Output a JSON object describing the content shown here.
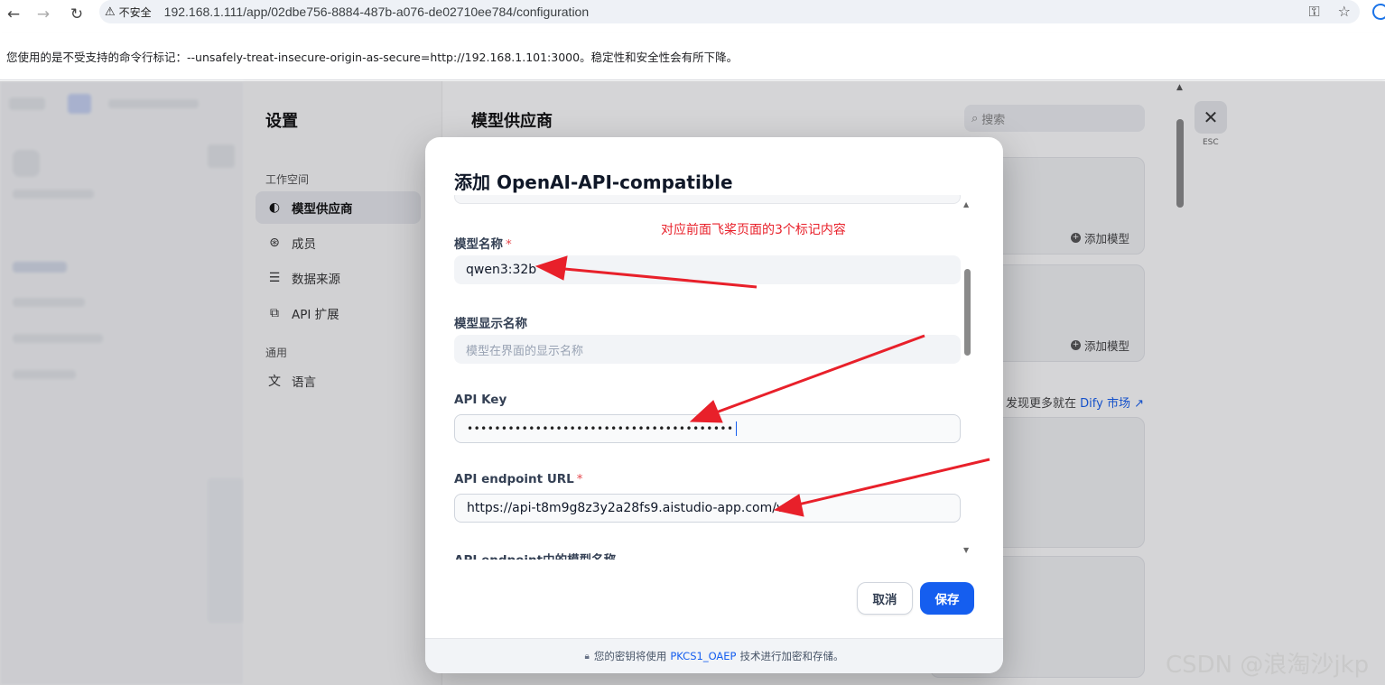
{
  "browser": {
    "insecure_label": "不安全",
    "url": "192.168.1.111/app/02dbe756-8884-487b-a076-de02710ee784/configuration",
    "infobar_text": "您使用的是不受支持的命令行标记：--unsafely-treat-insecure-origin-as-secure=http://192.168.1.101:3000。稳定性和安全性会有所下降。"
  },
  "settings": {
    "title": "设置",
    "workspace_label": "工作空间",
    "general_label": "通用",
    "items": [
      {
        "label": "模型供应商",
        "icon": "brain-icon"
      },
      {
        "label": "成员",
        "icon": "members-icon"
      },
      {
        "label": "数据来源",
        "icon": "database-icon"
      },
      {
        "label": "API 扩展",
        "icon": "puzzle-icon"
      },
      {
        "label": "语言",
        "icon": "translate-icon"
      }
    ]
  },
  "main": {
    "title": "模型供应商",
    "search_placeholder": "搜索",
    "add_model_label": "添加模型",
    "discover_text": "发现更多就在",
    "discover_link": "Dify 市场 ↗",
    "esc_label": "ESC"
  },
  "modal": {
    "title": "添加 OpenAI-API-compatible",
    "fields": {
      "model_name": {
        "label": "模型名称",
        "required": "*",
        "value": "qwen3:32b"
      },
      "display_name": {
        "label": "模型显示名称",
        "placeholder": "模型在界面的显示名称"
      },
      "api_key": {
        "label": "API Key",
        "value": "•••••••••••••••••••••••••••••••••••••••"
      },
      "endpoint_url": {
        "label": "API endpoint URL",
        "required": "*",
        "value": "https://api-t8m9g8z3y2a28fs9.aistudio-app.com/v1"
      },
      "endpoint_model_name": {
        "label": "API endpoint中的模型名称"
      }
    },
    "cancel_label": "取消",
    "save_label": "保存",
    "footer_prefix": "您的密钥将使用",
    "footer_link": "PKCS1_OAEP",
    "footer_suffix": "技术进行加密和存储。"
  },
  "annotation": {
    "text": "对应前面飞桨页面的3个标记内容",
    "color": "#e8202a"
  },
  "watermark": "CSDN @浪淘沙jkp",
  "colors": {
    "primary": "#155eef",
    "required": "#e5484d"
  }
}
